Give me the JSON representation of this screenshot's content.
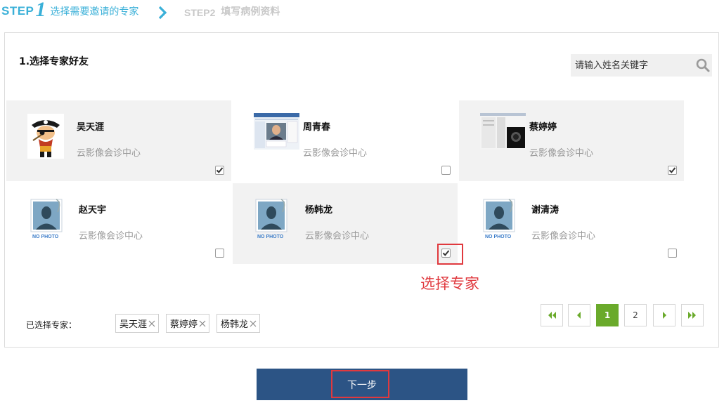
{
  "steps": {
    "step1_label": "STEP",
    "step1_num": "1",
    "step1_text": "选择需要邀请的专家",
    "step2_label": "STEP2",
    "step2_text": "填写病例资料"
  },
  "section_title": "1.选择专家好友",
  "search": {
    "placeholder": "请输入姓名关键字"
  },
  "experts": [
    {
      "name": "吴天涯",
      "org": "云影像会诊中心",
      "checked": true,
      "avatar": "pirate-cartoon"
    },
    {
      "name": "周青春",
      "org": "云影像会诊中心",
      "checked": false,
      "avatar": "screenshot-photo"
    },
    {
      "name": "蔡婷婷",
      "org": "云影像会诊中心",
      "checked": true,
      "avatar": "screenshot-photo"
    },
    {
      "name": "赵天宇",
      "org": "云影像会诊中心",
      "checked": false,
      "avatar": "no-photo"
    },
    {
      "name": "杨韩龙",
      "org": "云影像会诊中心",
      "checked": true,
      "avatar": "no-photo"
    },
    {
      "name": "谢清涛",
      "org": "云影像会诊中心",
      "checked": false,
      "avatar": "no-photo"
    }
  ],
  "no_photo_text": "NO PHOTO",
  "annotation": "选择专家",
  "pagination": {
    "pages": [
      "1",
      "2"
    ],
    "current": "1"
  },
  "selected": {
    "label": "已选择专家：",
    "items": [
      "吴天涯",
      "蔡婷婷",
      "杨韩龙"
    ]
  },
  "next_button": "下一步",
  "colors": {
    "accent": "#3ab0d8",
    "primary": "#2c5485",
    "pager_active": "#6aaa2b",
    "highlight": "#e0393e"
  }
}
